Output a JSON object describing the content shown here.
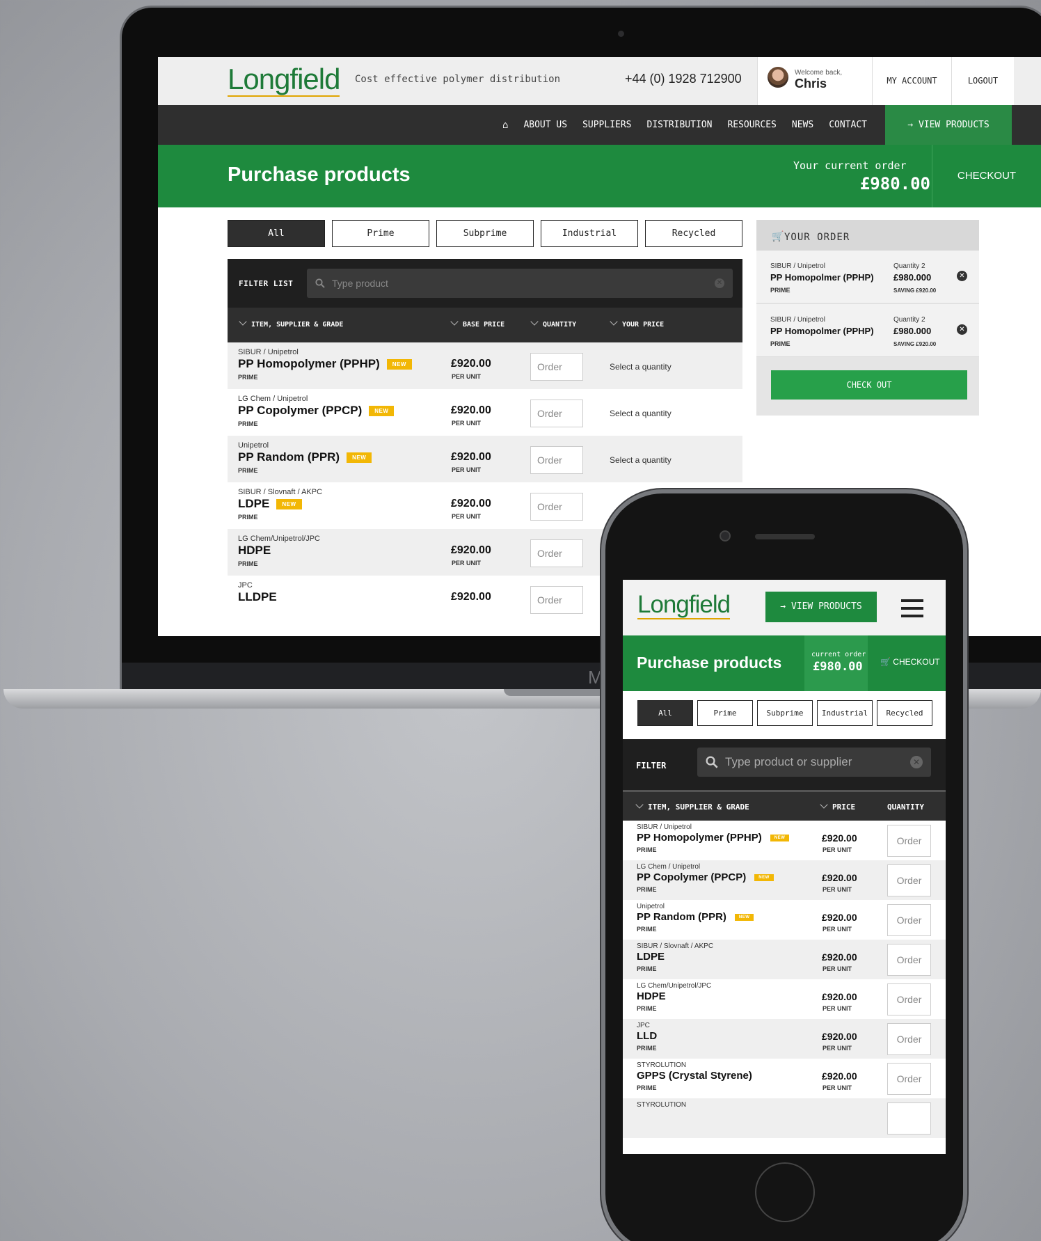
{
  "desktop": {
    "logo": "Longfield",
    "tagline": "Cost effective polymer distribution",
    "phone": "+44 (0) 1928 712900",
    "welcome": "Welcome back,",
    "user": "Chris",
    "my_account": "MY ACCOUNT",
    "logout": "LOGOUT",
    "nav": [
      "ABOUT US",
      "SUPPLIERS",
      "DISTRIBUTION",
      "RESOURCES",
      "NEWS",
      "CONTACT"
    ],
    "view_products": "→ VIEW PRODUCTS",
    "title": "Purchase products",
    "current_order_label": "Your current order",
    "current_order_value": "£980.00",
    "checkout": "CHECKOUT",
    "tabs": [
      "All",
      "Prime",
      "Subprime",
      "Industrial",
      "Recycled"
    ],
    "filter_label": "FILTER LIST",
    "search_placeholder": "Type product",
    "columns": [
      "ITEM, SUPPLIER & GRADE",
      "BASE PRICE",
      "QUANTITY",
      "YOUR PRICE"
    ],
    "rows": [
      {
        "supplier": "SIBUR / Unipetrol",
        "name": "PP Homopolymer (PPHP)",
        "badge": "NEW",
        "grade": "PRIME",
        "price": "£920.00",
        "per": "PER UNIT",
        "order": "Order",
        "your_price": "Select a quantity"
      },
      {
        "supplier": "LG Chem / Unipetrol",
        "name": "PP Copolymer (PPCP)",
        "badge": "NEW",
        "grade": "PRIME",
        "price": "£920.00",
        "per": "PER UNIT",
        "order": "Order",
        "your_price": "Select a quantity"
      },
      {
        "supplier": "Unipetrol",
        "name": "PP Random (PPR)",
        "badge": "NEW",
        "grade": "PRIME",
        "price": "£920.00",
        "per": "PER UNIT",
        "order": "Order",
        "your_price": "Select a quantity"
      },
      {
        "supplier": "SIBUR / Slovnaft / AKPC",
        "name": "LDPE",
        "badge": "NEW",
        "grade": "PRIME",
        "price": "£920.00",
        "per": "PER UNIT",
        "order": "Order",
        "your_price": ""
      },
      {
        "supplier": "LG Chem/Unipetrol/JPC",
        "name": "HDPE",
        "badge": "",
        "grade": "PRIME",
        "price": "£920.00",
        "per": "PER UNIT",
        "order": "Order",
        "your_price": ""
      },
      {
        "supplier": "JPC",
        "name": "LLDPE",
        "badge": "",
        "grade": "",
        "price": "£920.00",
        "per": "",
        "order": "Order",
        "your_price": ""
      }
    ],
    "order_panel": {
      "title": "YOUR ORDER",
      "items": [
        {
          "supplier": "SIBUR / Unipetrol",
          "name": "PP Homopolmer (PPHP)",
          "grade": "PRIME",
          "qty": "Quantity 2",
          "value": "£980.000",
          "saving": "SAVING £920.00"
        },
        {
          "supplier": "SIBUR / Unipetrol",
          "name": "PP Homopolmer (PPHP)",
          "grade": "PRIME",
          "qty": "Quantity 2",
          "value": "£980.000",
          "saving": "SAVING £920.00"
        }
      ],
      "check_out": "CHECK OUT"
    },
    "brand_letter": "M"
  },
  "mobile": {
    "logo": "Longfield",
    "view_products": "→ VIEW PRODUCTS",
    "title": "Purchase products",
    "current_order_label": "current order",
    "current_order_value": "£980.00",
    "checkout": "CHECKOUT",
    "tabs": [
      "All",
      "Prime",
      "Subprime",
      "Industrial",
      "Recycled"
    ],
    "filter_label": "FILTER",
    "search_placeholder": "Type product or supplier",
    "columns": [
      "ITEM, SUPPLIER & GRADE",
      "PRICE",
      "QUANTITY"
    ],
    "rows": [
      {
        "supplier": "SIBUR / Unipetrol",
        "name": "PP Homopolymer (PPHP)",
        "badge": "NEW",
        "grade": "PRIME",
        "price": "£920.00",
        "per": "PER UNIT",
        "order": "Order"
      },
      {
        "supplier": "LG Chem / Unipetrol",
        "name": "PP Copolymer (PPCP)",
        "badge": "NEW",
        "grade": "PRIME",
        "price": "£920.00",
        "per": "PER UNIT",
        "order": "Order"
      },
      {
        "supplier": "Unipetrol",
        "name": "PP Random (PPR)",
        "badge": "NEW",
        "grade": "PRIME",
        "price": "£920.00",
        "per": "PER UNIT",
        "order": "Order"
      },
      {
        "supplier": "SIBUR / Slovnaft / AKPC",
        "name": "LDPE",
        "badge": "",
        "grade": "PRIME",
        "price": "£920.00",
        "per": "PER UNIT",
        "order": "Order"
      },
      {
        "supplier": "LG Chem/Unipetrol/JPC",
        "name": "HDPE",
        "badge": "",
        "grade": "PRIME",
        "price": "£920.00",
        "per": "PER UNIT",
        "order": "Order"
      },
      {
        "supplier": "JPC",
        "name": "LLD",
        "badge": "",
        "grade": "PRIME",
        "price": "£920.00",
        "per": "PER UNIT",
        "order": "Order"
      },
      {
        "supplier": "STYROLUTION",
        "name": "GPPS (Crystal Styrene)",
        "badge": "",
        "grade": "PRIME",
        "price": "£920.00",
        "per": "PER UNIT",
        "order": "Order"
      },
      {
        "supplier": "STYROLUTION",
        "name": "",
        "badge": "",
        "grade": "",
        "price": "",
        "per": "",
        "order": ""
      }
    ]
  },
  "colors": {
    "green": "#1e8a3e",
    "dark": "#2f2f2f",
    "badge": "#f2b705"
  }
}
